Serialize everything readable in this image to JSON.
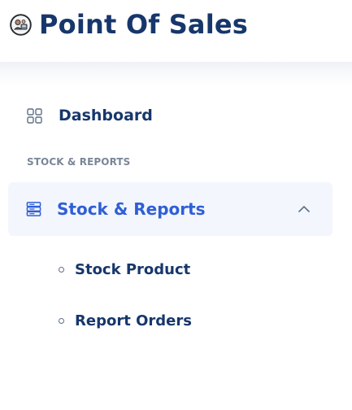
{
  "brand": {
    "title": "Point Of Sales",
    "logo_icon": "cashier-avatar-icon",
    "color": "#17376b"
  },
  "sidebar": {
    "items": [
      {
        "label": "Dashboard",
        "icon": "grid-icon",
        "active": false
      }
    ],
    "section_header": "STOCK & REPORTS",
    "group": {
      "label": "Stock & Reports",
      "icon": "stack-list-icon",
      "expanded": true,
      "active": true,
      "chevron_icon": "chevron-up-icon",
      "sub_items": [
        {
          "label": "Stock Product",
          "icon": "circle-bullet-icon"
        },
        {
          "label": "Report Orders",
          "icon": "circle-bullet-icon"
        }
      ]
    }
  },
  "colors": {
    "text_primary": "#17376b",
    "accent": "#2f5fd6",
    "active_bg": "#f3f6fd",
    "muted": "#7a8698"
  }
}
